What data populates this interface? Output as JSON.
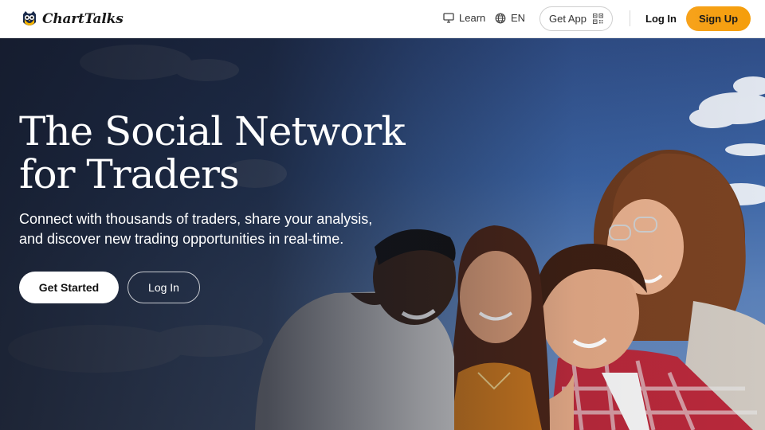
{
  "brand": {
    "name": "ChartTalks",
    "logo_icon": "owl-logo-icon"
  },
  "nav": {
    "learn": {
      "label": "Learn",
      "icon": "monitor-icon"
    },
    "language": {
      "label": "EN",
      "icon": "globe-icon"
    },
    "get_app": {
      "label": "Get App",
      "icon": "qr-code-icon"
    },
    "login": "Log In",
    "signup": "Sign Up"
  },
  "hero": {
    "title_line1": "The Social Network",
    "title_line2": "for Traders",
    "subtitle_line1": "Connect with thousands of traders, share your analysis,",
    "subtitle_line2": "and discover new trading opportunities in real-time.",
    "cta_primary": "Get Started",
    "cta_secondary": "Log In",
    "image": "group-of-friends-looking-at-phone"
  },
  "colors": {
    "accent": "#f59e0b",
    "header_bg": "#ffffff",
    "hero_text": "#ffffff",
    "sky": "#3b63a3"
  }
}
